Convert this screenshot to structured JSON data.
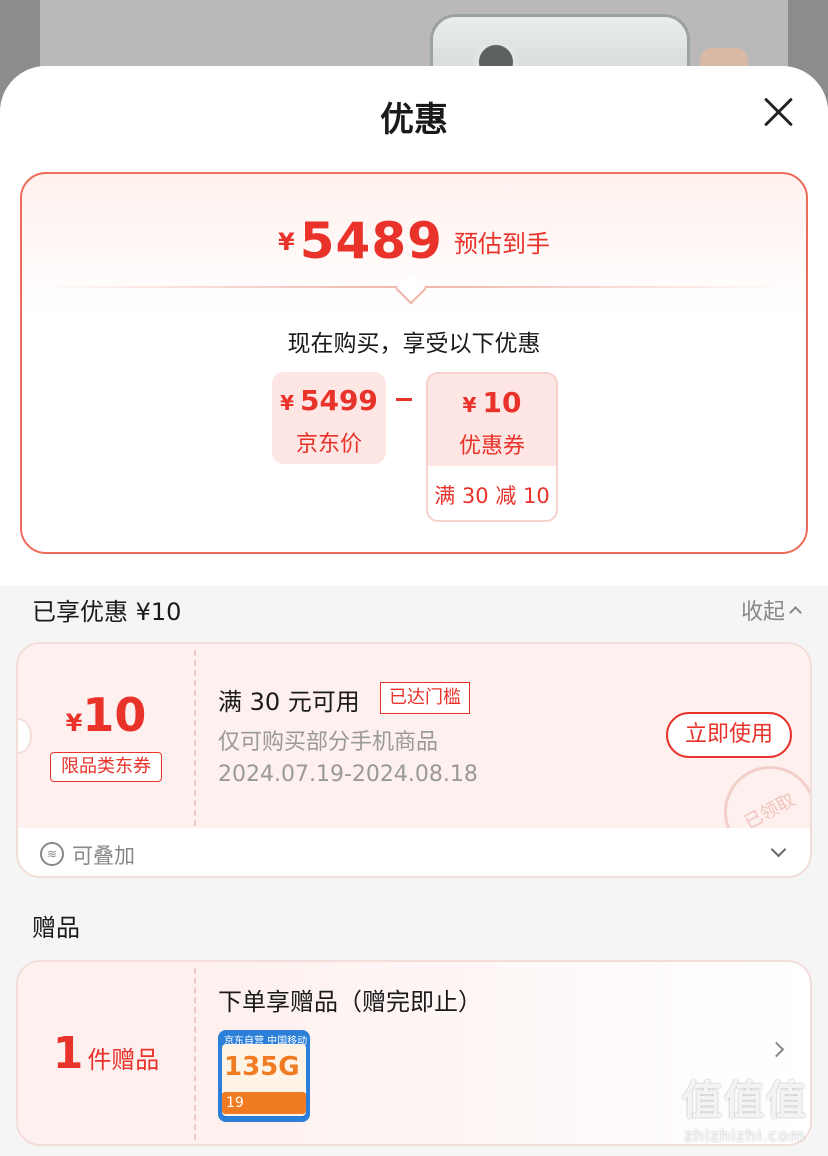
{
  "sheet": {
    "title": "优惠",
    "close_icon": "close-icon"
  },
  "summary": {
    "currency": "¥",
    "final_price": "5489",
    "final_tag": "预估到手",
    "subline": "现在购买，享受以下优惠",
    "price_chip": {
      "currency": "¥",
      "value": "5499",
      "label": "京东价"
    },
    "coupon_chip": {
      "currency": "¥",
      "value": "10",
      "label": "优惠券",
      "rule": "满 30 减 10"
    }
  },
  "enjoyed": {
    "title": "已享优惠 ¥10",
    "collapse_label": "收起"
  },
  "coupon": {
    "currency": "¥",
    "amount": "10",
    "scope": "限品类东券",
    "title": "满 30 元可用",
    "reached": "已达门槛",
    "description": "仅可购买部分手机商品",
    "date_range": "2024.07.19-2024.08.18",
    "use_button": "立即使用",
    "stamp": "已领取",
    "stackable_label": "可叠加"
  },
  "gifts": {
    "section_title": "赠品",
    "count": "1",
    "count_label": "件赠品",
    "title": "下单享赠品（赠完即止）",
    "thumb_top": "京东自营 中国移动",
    "thumb_big": "135G",
    "thumb_bar": "19"
  },
  "watermark": {
    "logo": "值值值",
    "site": "zhizhizhi.com"
  },
  "colors": {
    "accent": "#e8322a",
    "accent_light": "#fde6e3",
    "border": "#ee6b5a"
  }
}
